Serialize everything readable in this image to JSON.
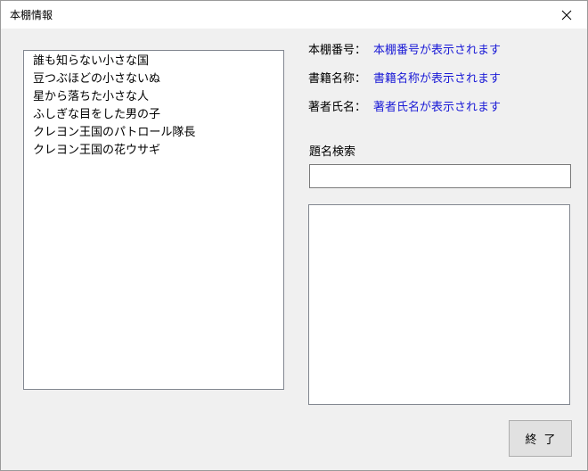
{
  "window": {
    "title": "本棚情報",
    "close_icon": "close-icon"
  },
  "book_list": {
    "items": [
      "誰も知らない小さな国",
      "豆つぶほどの小さないぬ",
      "星から落ちた小さな人",
      "ふしぎな目をした男の子",
      "クレヨン王国のパトロール隊長",
      "クレヨン王国の花ウサギ"
    ]
  },
  "info": {
    "shelf_number_label": "本棚番号：",
    "shelf_number_value": "本棚番号が表示されます",
    "book_name_label": "書籍名称：",
    "book_name_value": "書籍名称が表示されます",
    "author_label": "著者氏名：",
    "author_value": "著者氏名が表示されます",
    "value_color": "#1a1ad6"
  },
  "search": {
    "label": "題名検索",
    "value": ""
  },
  "footer": {
    "end_button_label": "終了"
  }
}
